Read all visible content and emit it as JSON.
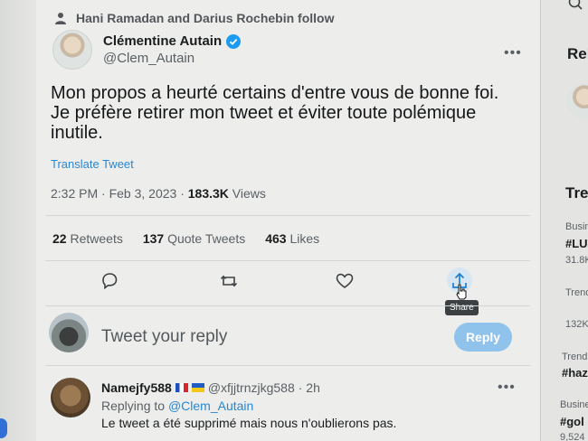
{
  "social_context": "Hani Ramadan and Darius Rochebin follow",
  "author": {
    "name": "Clémentine Autain",
    "handle": "@Clem_Autain"
  },
  "tweet": {
    "text": "Mon propos a heurté certains d'entre vous de bonne foi. Je préfère retirer mon tweet et éviter toute polémique inutile.",
    "translate_label": "Translate Tweet",
    "time": "2:32 PM · Feb 3, 2023 · ",
    "views_count": "183.3K",
    "views_label": " Views"
  },
  "stats": {
    "retweets_count": "22",
    "retweets_label": "Retweets",
    "quotes_count": "137",
    "quotes_label": "Quote Tweets",
    "likes_count": "463",
    "likes_label": "Likes"
  },
  "actions": {
    "share_tooltip": "Share"
  },
  "reply_box": {
    "placeholder": "Tweet your reply",
    "button_label": "Reply"
  },
  "comment": {
    "name": "Namejfy588",
    "handle": "@xfjjtrnzjkg588",
    "time": "· 2h",
    "replying_prefix": "Replying to ",
    "replying_handle": "@Clem_Autain",
    "text": "Le tweet a été supprimé mais nous n'oublierons pas."
  },
  "right_column": {
    "title1": "Rel",
    "title2": "Tre",
    "item1_category": "Busin",
    "item1_tag": "#LU",
    "item1_count": "31.8K",
    "item2_category": "Trend",
    "item2_count": "132K",
    "item3_category": "Trend",
    "item3_tag": "#haz",
    "item4_category": "Busine",
    "item4_tag": "#gol",
    "item4_count": "9,524"
  },
  "colors": {
    "accent": "#2a86d1",
    "reply_button": "#90c3ec",
    "verified": "#1d9bf0"
  }
}
